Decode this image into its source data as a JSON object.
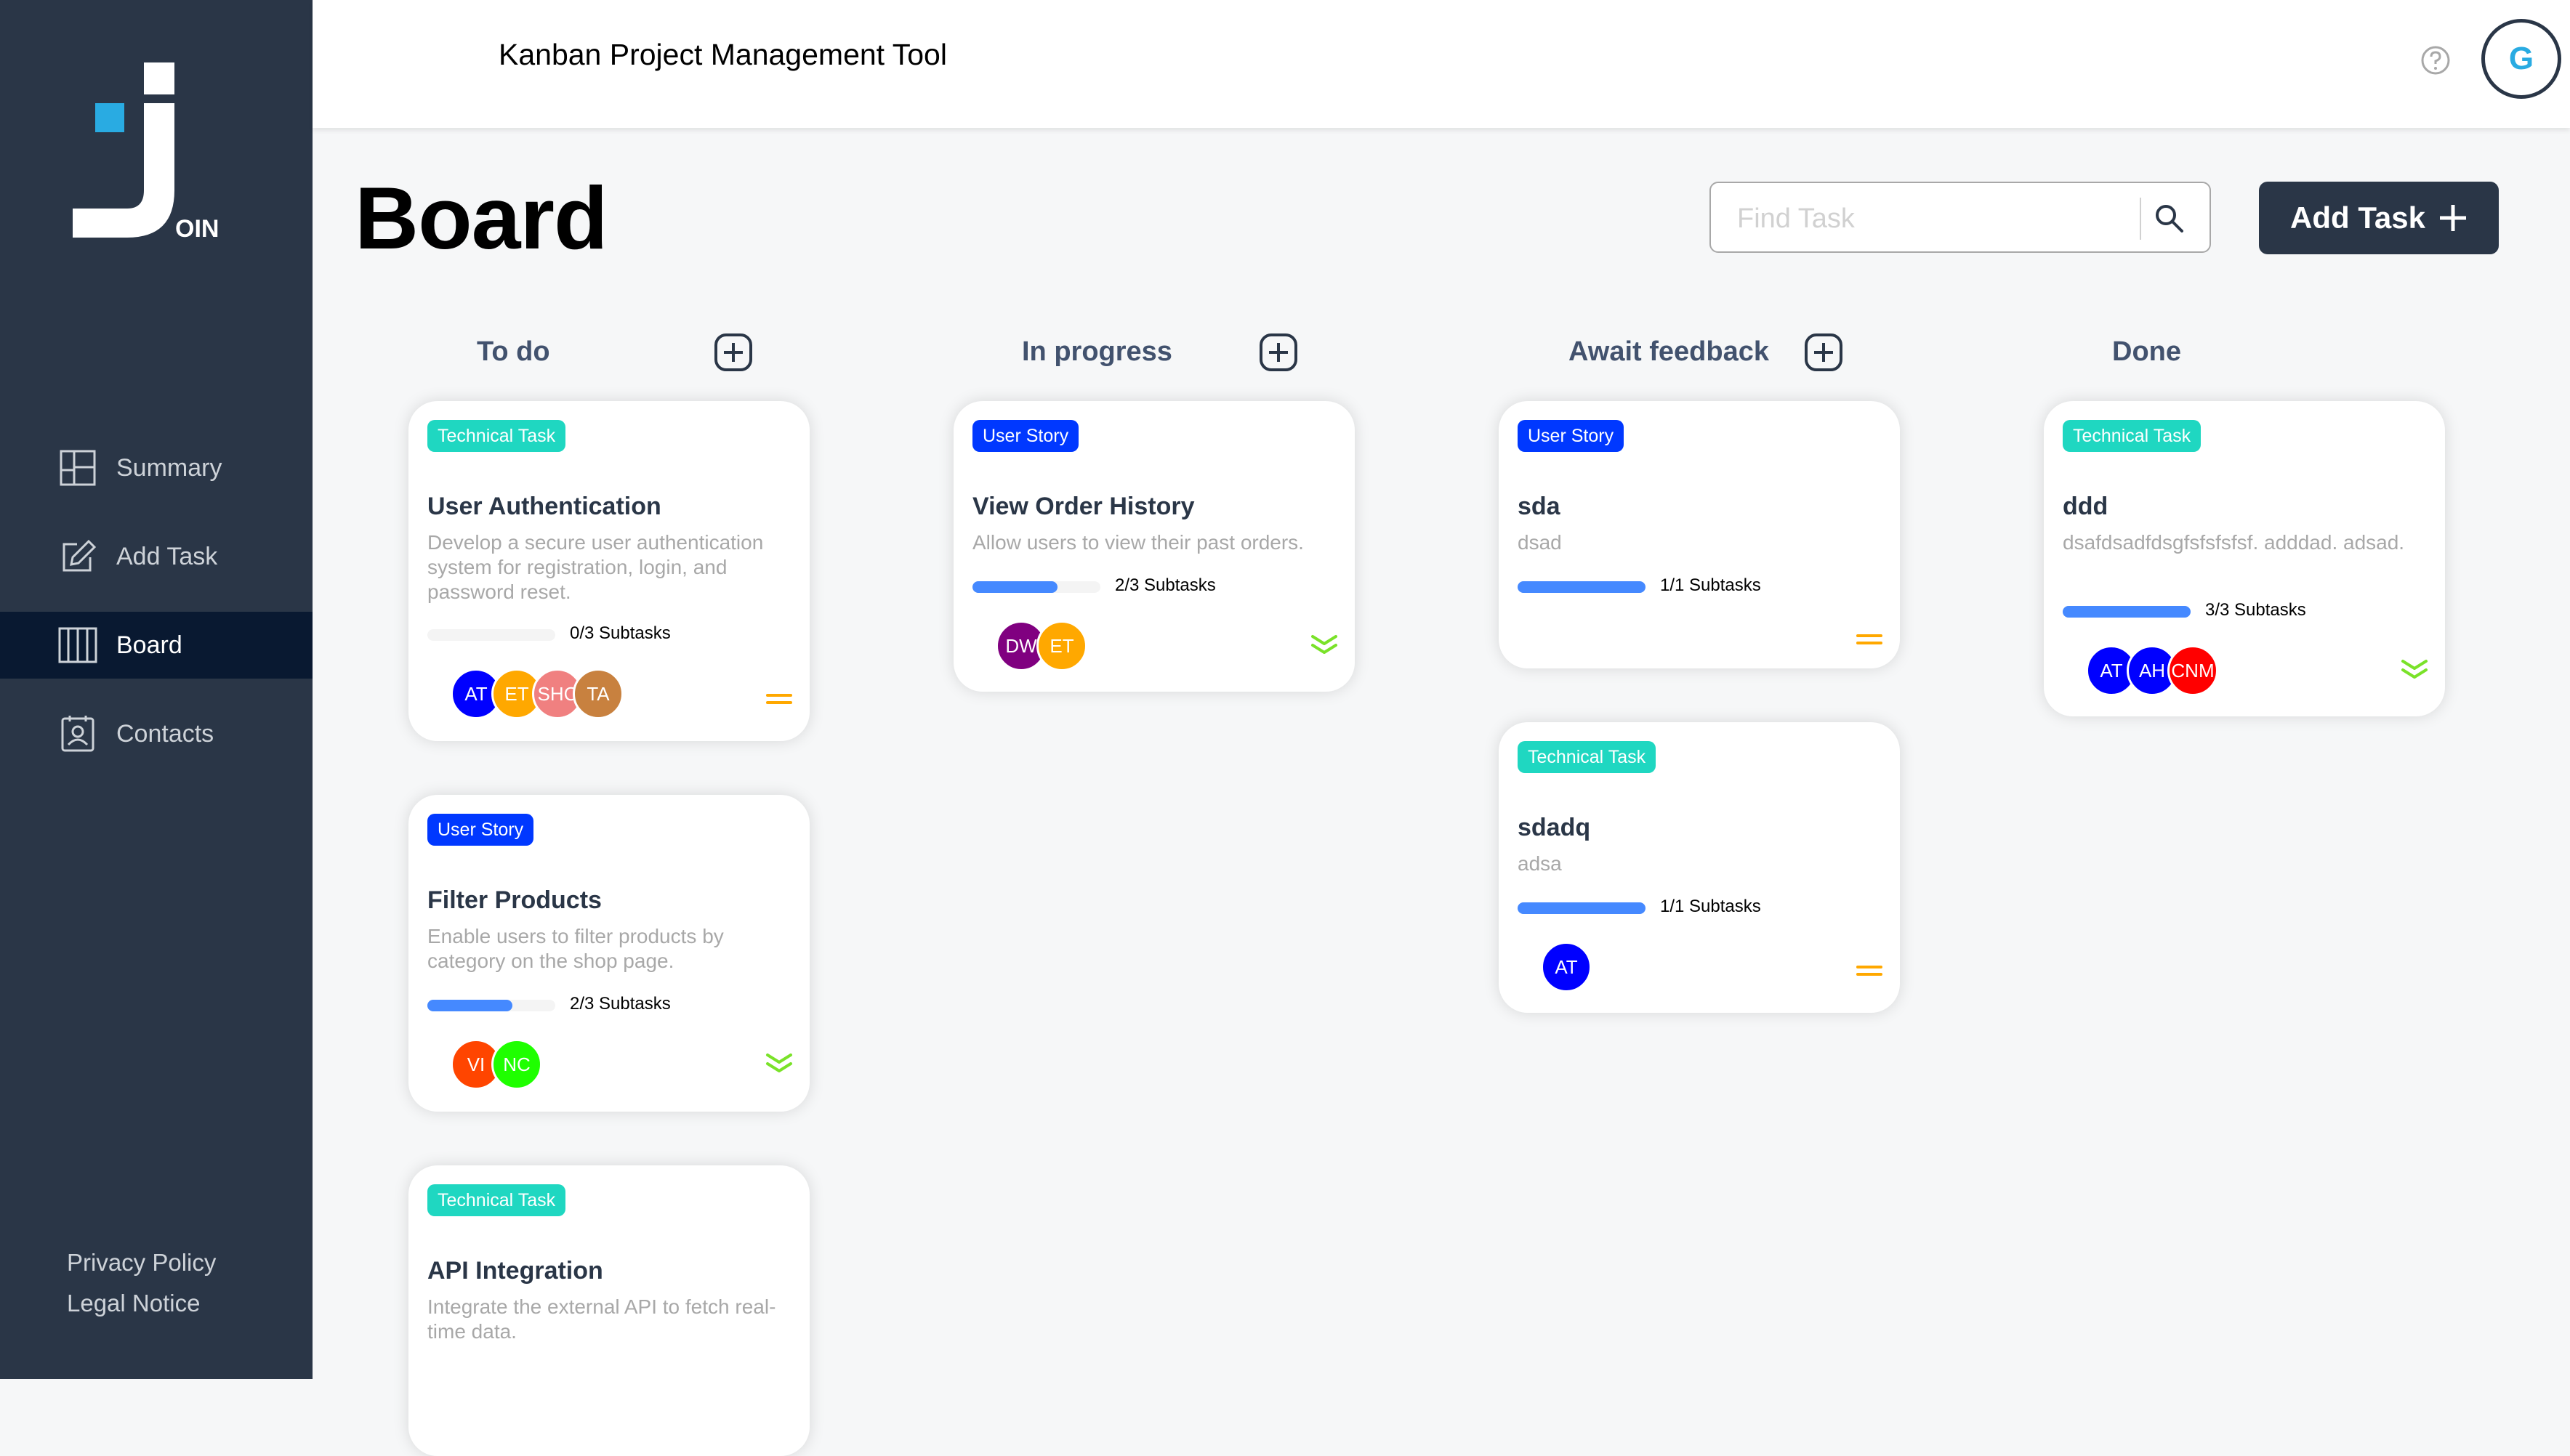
{
  "app": {
    "header_title": "Kanban Project Management Tool",
    "logo_text": "OIN",
    "user_initial": "G"
  },
  "sidebar": {
    "items": [
      {
        "label": "Summary",
        "icon": "summary-icon"
      },
      {
        "label": "Add Task",
        "icon": "edit-icon"
      },
      {
        "label": "Board",
        "icon": "board-icon",
        "active": true
      },
      {
        "label": "Contacts",
        "icon": "contacts-icon"
      }
    ],
    "privacy": "Privacy Policy",
    "legal": "Legal Notice"
  },
  "board": {
    "title": "Board",
    "search_placeholder": "Find Task",
    "add_task_label": "Add Task"
  },
  "columns": [
    {
      "title": "To do",
      "has_add": true
    },
    {
      "title": "In progress",
      "has_add": true
    },
    {
      "title": "Await feedback",
      "has_add": true
    },
    {
      "title": "Done",
      "has_add": false
    }
  ],
  "cards": [
    {
      "category": "Technical Task",
      "title": "User Authentication",
      "desc": "Develop a secure user authentication system for registration, login, and password reset.",
      "subtasks": "0/3 Subtasks",
      "progress": 0.0,
      "assignees": [
        {
          "i": "AT",
          "c": "#0000ff"
        },
        {
          "i": "ET",
          "c": "#ffa800"
        },
        {
          "i": "SHC",
          "c": "#f08080"
        },
        {
          "i": "TA",
          "c": "#c8813f"
        }
      ],
      "priority": "medium"
    },
    {
      "category": "User Story",
      "title": "Filter Products",
      "desc": "Enable users to filter products by category on the shop page.",
      "subtasks": "2/3 Subtasks",
      "progress": 0.667,
      "assignees": [
        {
          "i": "VI",
          "c": "#ff4500"
        },
        {
          "i": "NC",
          "c": "#1fff00"
        }
      ],
      "priority": "low"
    },
    {
      "category": "Technical Task",
      "title": "API Integration",
      "desc": "Integrate the external API to fetch real-time data.",
      "subtasks": "",
      "progress": 0.0,
      "assignees": [],
      "priority": ""
    },
    {
      "category": "User Story",
      "title": "View Order History",
      "desc": "Allow users to view their past orders.",
      "subtasks": "2/3 Subtasks",
      "progress": 0.667,
      "assignees": [
        {
          "i": "DW",
          "c": "#800080"
        },
        {
          "i": "ET",
          "c": "#ffa800"
        }
      ],
      "priority": "low"
    },
    {
      "category": "User Story",
      "title": "sda",
      "desc": "dsad",
      "subtasks": "1/1 Subtasks",
      "progress": 1.0,
      "assignees": [],
      "priority": "medium"
    },
    {
      "category": "Technical Task",
      "title": "sdadq",
      "desc": "adsa",
      "subtasks": "1/1 Subtasks",
      "progress": 1.0,
      "assignees": [
        {
          "i": "AT",
          "c": "#0000ff"
        }
      ],
      "priority": "medium"
    },
    {
      "category": "Technical Task",
      "title": "ddd",
      "desc": "dsafdsadfdsgfsfsfsfsf. adddad. adsad.",
      "subtasks": "3/3 Subtasks",
      "progress": 1.0,
      "assignees": [
        {
          "i": "AT",
          "c": "#0000ff"
        },
        {
          "i": "AH",
          "c": "#0000ff"
        },
        {
          "i": "CNM",
          "c": "#ff0000"
        }
      ],
      "priority": "low"
    }
  ],
  "colors": {
    "sidebar": "#2a3647",
    "active_nav": "#091931",
    "tech_badge": "#1fd7c1",
    "story_badge": "#0038ff",
    "progress": "#4589ff",
    "prio_medium": "#ffa800",
    "prio_low": "#7ae229"
  }
}
